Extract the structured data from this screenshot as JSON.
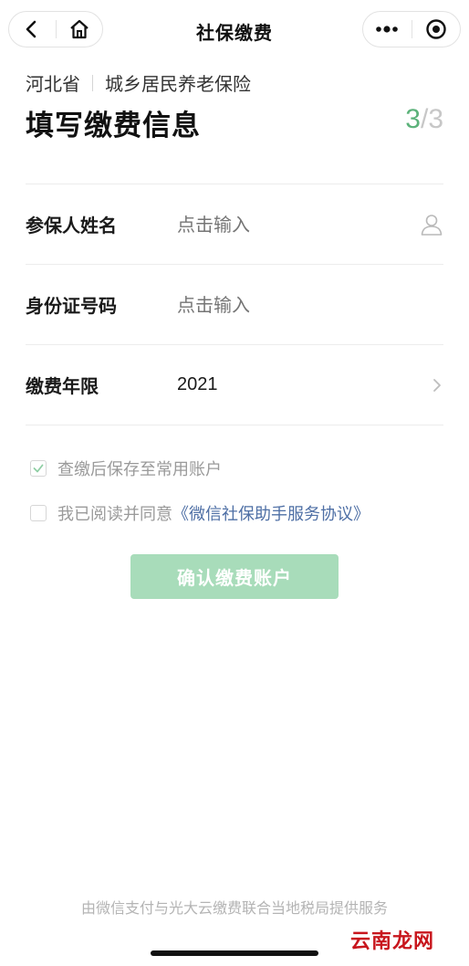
{
  "navbar": {
    "title": "社保缴费",
    "back_icon": "chevron-left-icon",
    "home_icon": "home-icon",
    "more_icon": "more-dots-icon",
    "close_icon": "target-circle-icon"
  },
  "header": {
    "province": "河北省",
    "insurance_type": "城乡居民养老保险",
    "title": "填写缴费信息",
    "step_current": "3",
    "step_sep": "/",
    "step_total": "3"
  },
  "form": {
    "name_label": "参保人姓名",
    "name_placeholder": "点击输入",
    "id_label": "身份证号码",
    "id_placeholder": "点击输入",
    "year_label": "缴费年限",
    "year_value": "2021"
  },
  "options": {
    "save_account_label": "查缴后保存至常用账户",
    "save_account_checked": true,
    "agree_prefix": "我已阅读并同意",
    "agree_link": "《微信社保助手服务协议》",
    "agree_checked": false
  },
  "confirm_label": "确认缴费账户",
  "footer_note": "由微信支付与光大云缴费联合当地税局提供服务",
  "watermark_text": "云南龙网",
  "colors": {
    "accent": "#5cb27a",
    "button_disabled": "#a8dcba",
    "link": "#4e6fa5"
  }
}
